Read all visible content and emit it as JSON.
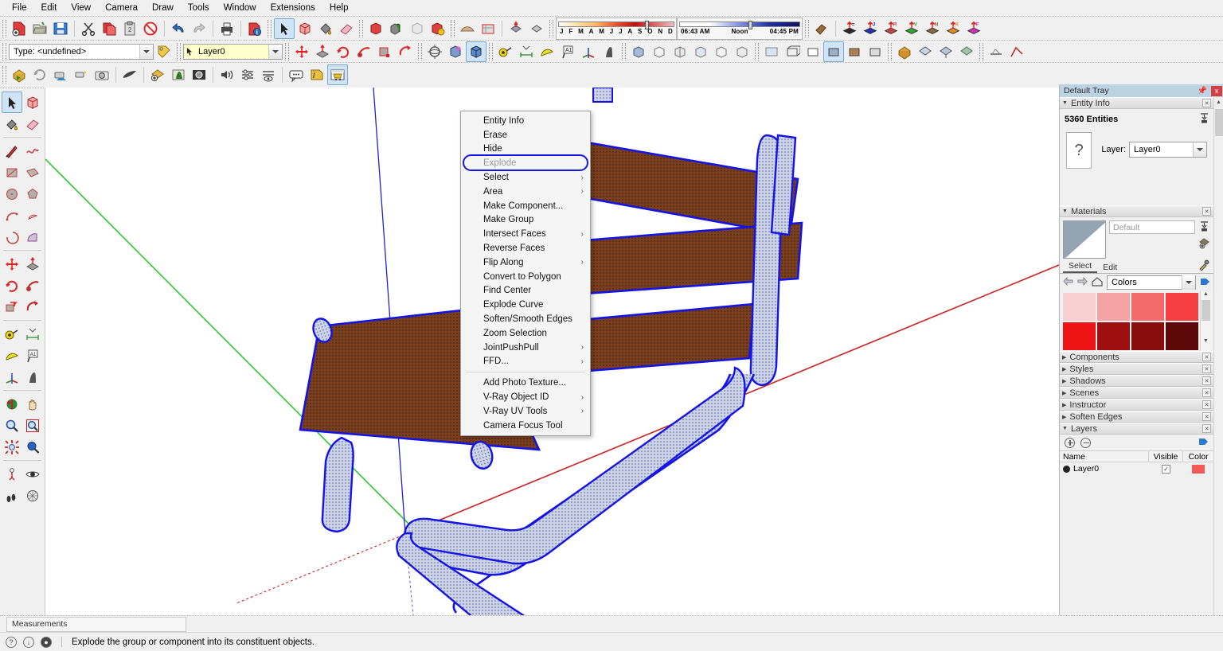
{
  "menubar": {
    "items": [
      {
        "label": "File"
      },
      {
        "label": "Edit"
      },
      {
        "label": "View"
      },
      {
        "label": "Camera"
      },
      {
        "label": "Draw"
      },
      {
        "label": "Tools"
      },
      {
        "label": "Window"
      },
      {
        "label": "Extensions"
      },
      {
        "label": "Help"
      }
    ]
  },
  "toolbar_row2": {
    "type_field": {
      "label": "Type: <undefined>",
      "icon": "paint-tag-icon"
    },
    "layer_field": {
      "value": "Layer0",
      "icon": "cursor-arrow-icon"
    }
  },
  "shadow_toolbar": {
    "months": [
      "J",
      "F",
      "M",
      "A",
      "M",
      "J",
      "J",
      "A",
      "S",
      "O",
      "N",
      "D"
    ],
    "time_start": "06:43 AM",
    "time_noon": "Noon",
    "time_end": "04:45 PM"
  },
  "layer_color_buttons": [
    {
      "letter": "=",
      "color": "#2b2b2b",
      "name": "layer-button-default"
    },
    {
      "letter": "J",
      "color": "#2233bb",
      "name": "layer-button-j"
    },
    {
      "letter": "R",
      "color": "#cc4444",
      "name": "layer-button-r"
    },
    {
      "letter": "V",
      "color": "#2ea82e",
      "name": "layer-button-v"
    },
    {
      "letter": "N",
      "color": "#8a6a3a",
      "name": "layer-button-n"
    },
    {
      "letter": "X",
      "color": "#e88a1a",
      "name": "layer-button-x"
    },
    {
      "letter": "F",
      "color": "#cc33bb",
      "name": "layer-button-f"
    }
  ],
  "context_menu": {
    "highlighted": "Explode",
    "items": [
      {
        "label": "Entity Info",
        "submenu": false,
        "disabled": false
      },
      {
        "label": "Erase",
        "submenu": false,
        "disabled": false
      },
      {
        "label": "Hide",
        "submenu": false,
        "disabled": false
      },
      {
        "label": "Explode",
        "submenu": false,
        "disabled": true,
        "highlight": true
      },
      {
        "label": "Select",
        "submenu": true,
        "disabled": false
      },
      {
        "label": "Area",
        "submenu": true,
        "disabled": false
      },
      {
        "label": "Make Component...",
        "submenu": false,
        "disabled": false
      },
      {
        "label": "Make Group",
        "submenu": false,
        "disabled": false
      },
      {
        "label": "Intersect Faces",
        "submenu": true,
        "disabled": false
      },
      {
        "label": "Reverse Faces",
        "submenu": false,
        "disabled": false
      },
      {
        "label": "Flip Along",
        "submenu": true,
        "disabled": false
      },
      {
        "label": "Convert to Polygon",
        "submenu": false,
        "disabled": false
      },
      {
        "label": "Find Center",
        "submenu": false,
        "disabled": false
      },
      {
        "label": "Explode Curve",
        "submenu": false,
        "disabled": false
      },
      {
        "label": "Soften/Smooth Edges",
        "submenu": false,
        "disabled": false
      },
      {
        "label": "Zoom Selection",
        "submenu": false,
        "disabled": false
      },
      {
        "label": "JointPushPull",
        "submenu": true,
        "disabled": false
      },
      {
        "label": "FFD...",
        "submenu": true,
        "disabled": false
      },
      {
        "separator": true
      },
      {
        "label": "Add Photo Texture...",
        "submenu": false,
        "disabled": false
      },
      {
        "label": "V-Ray Object ID",
        "submenu": true,
        "disabled": false
      },
      {
        "label": "V-Ray UV Tools",
        "submenu": true,
        "disabled": false
      },
      {
        "label": "Camera Focus Tool",
        "submenu": false,
        "disabled": false
      }
    ]
  },
  "tray": {
    "title": "Default Tray",
    "pin_icon": "pin-icon",
    "close_label": "x",
    "panels": [
      {
        "label": "Entity Info",
        "expanded": true
      },
      {
        "label": "Materials",
        "expanded": true
      },
      {
        "label": "Components",
        "expanded": false
      },
      {
        "label": "Styles",
        "expanded": false
      },
      {
        "label": "Shadows",
        "expanded": false
      },
      {
        "label": "Scenes",
        "expanded": false
      },
      {
        "label": "Instructor",
        "expanded": false
      },
      {
        "label": "Soften Edges",
        "expanded": false
      },
      {
        "label": "Layers",
        "expanded": true
      }
    ],
    "entity_info": {
      "count_label": "5360 Entities",
      "thumb_glyph": "?",
      "layer_label": "Layer:",
      "layer_value": "Layer0"
    },
    "materials": {
      "name_placeholder": "Default",
      "tabs": [
        {
          "label": "Select",
          "selected": true
        },
        {
          "label": "Edit",
          "selected": false
        }
      ],
      "collection": "Colors",
      "swatches": [
        "#f7cfd0",
        "#f6a3a5",
        "#f46a6b",
        "#f53e3f",
        "#ee1414",
        "#9e1010",
        "#8a0d0d",
        "#5c0808"
      ]
    },
    "layers": {
      "columns": [
        "Name",
        "Visible",
        "Color"
      ],
      "rows": [
        {
          "name": "Layer0",
          "visible": true,
          "color": "#f25a5a"
        }
      ]
    }
  },
  "collapsed_panels": [
    "Components",
    "Styles",
    "Shadows",
    "Scenes",
    "Instructor",
    "Soften Edges"
  ],
  "measurements": {
    "label": "Measurements",
    "value": ""
  },
  "statusbar": {
    "hint": "Explode the group or component into its constituent objects.",
    "icons": [
      "help-icon",
      "info-icon",
      "account-icon"
    ]
  },
  "viewport": {
    "background": "#ffffff",
    "axis_green": "#22bb22",
    "axis_red": "#cc2222",
    "axis_blue": "#2222cc",
    "selection_color": "#1414e6",
    "seat_color": "#7a3f1e",
    "frame_color": "#c8cfe0",
    "model_description": "chair-model-selected"
  }
}
